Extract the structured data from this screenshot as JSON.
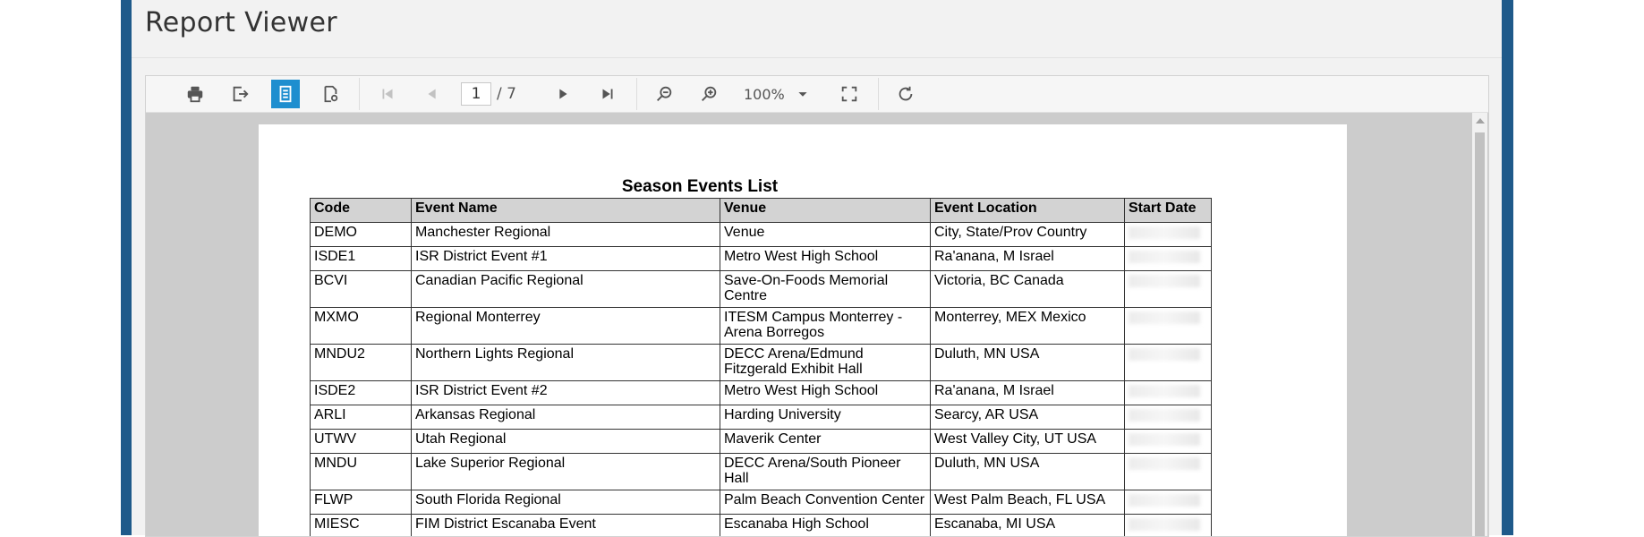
{
  "app": {
    "title": "Report Viewer"
  },
  "toolbar": {
    "buttons": [
      {
        "name": "print",
        "icon": "printer-icon",
        "enabled": true
      },
      {
        "name": "export",
        "icon": "export-icon",
        "enabled": true
      },
      {
        "name": "print-layout",
        "icon": "document-icon",
        "enabled": true,
        "active": true
      },
      {
        "name": "page-setup",
        "icon": "page-setup-icon",
        "enabled": true
      },
      {
        "name": "first-page",
        "icon": "skip-first-icon",
        "enabled": false
      },
      {
        "name": "previous-page",
        "icon": "previous-icon",
        "enabled": false
      },
      {
        "name": "next-page",
        "icon": "next-icon",
        "enabled": true
      },
      {
        "name": "last-page",
        "icon": "skip-last-icon",
        "enabled": true
      },
      {
        "name": "zoom-out",
        "icon": "zoom-out-icon",
        "enabled": true
      },
      {
        "name": "zoom-in",
        "icon": "zoom-in-icon",
        "enabled": true
      },
      {
        "name": "fit-page",
        "icon": "fit-page-icon",
        "enabled": true
      },
      {
        "name": "refresh",
        "icon": "refresh-icon",
        "enabled": true
      }
    ],
    "page": {
      "current": "1",
      "total": "/ 7"
    },
    "zoom": "100%"
  },
  "colors": {
    "frame": "#1f5a8a",
    "active_button": "#1e8ecf",
    "header_fill": "#d3d3d3",
    "canvas": "#cccccc"
  },
  "report": {
    "title": "Season Events List",
    "columns": [
      "Code",
      "Event Name",
      "Venue",
      "Event Location",
      "Start Date"
    ],
    "rows": [
      {
        "code": "DEMO",
        "event": "Manchester Regional",
        "venue": "Venue",
        "location": "City, State/Prov Country"
      },
      {
        "code": "ISDE1",
        "event": "ISR District Event #1",
        "venue": "Metro West High School",
        "location": "Ra'anana, M Israel"
      },
      {
        "code": "BCVI",
        "event": "Canadian Pacific Regional",
        "venue": "Save-On-Foods Memorial Centre",
        "location": "Victoria, BC Canada"
      },
      {
        "code": "MXMO",
        "event": "Regional Monterrey",
        "venue": "ITESM Campus Monterrey - Arena Borregos",
        "location": "Monterrey, MEX Mexico"
      },
      {
        "code": "MNDU2",
        "event": "Northern Lights Regional",
        "venue": "DECC Arena/Edmund Fitzgerald Exhibit Hall",
        "location": "Duluth, MN USA"
      },
      {
        "code": "ISDE2",
        "event": "ISR District Event #2",
        "venue": "Metro West High School",
        "location": "Ra'anana, M Israel"
      },
      {
        "code": "ARLI",
        "event": "Arkansas Regional",
        "venue": "Harding University",
        "location": "Searcy, AR USA"
      },
      {
        "code": "UTWV",
        "event": "Utah Regional",
        "venue": "Maverik Center",
        "location": "West Valley City, UT USA"
      },
      {
        "code": "MNDU",
        "event": "Lake Superior Regional",
        "venue": "DECC Arena/South Pioneer Hall",
        "location": "Duluth, MN USA"
      },
      {
        "code": "FLWP",
        "event": "South Florida Regional",
        "venue": "Palm Beach Convention Center",
        "location": "West Palm Beach, FL USA"
      },
      {
        "code": "MIESC",
        "event": "FIM District Escanaba Event",
        "venue": "Escanaba High School",
        "location": "Escanaba, MI USA"
      }
    ]
  }
}
